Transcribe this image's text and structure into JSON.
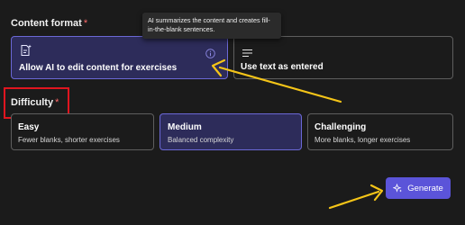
{
  "content_format": {
    "label": "Content format",
    "required_marker": "*",
    "tooltip": "AI summarizes the content and creates fill-in-the-blank sentences.",
    "options": [
      {
        "title": "Allow AI to edit content for exercises",
        "icon": "ai-edit-icon",
        "selected": true
      },
      {
        "title": "Use text as entered",
        "icon": "text-lines-icon",
        "selected": false
      }
    ]
  },
  "difficulty": {
    "label": "Difficulty",
    "required_marker": "*",
    "options": [
      {
        "title": "Easy",
        "description": "Fewer blanks, shorter exercises",
        "selected": false
      },
      {
        "title": "Medium",
        "description": "Balanced complexity",
        "selected": true
      },
      {
        "title": "Challenging",
        "description": "More blanks, longer exercises",
        "selected": false
      }
    ]
  },
  "generate_button": {
    "label": "Generate",
    "icon": "sparkle-icon"
  },
  "colors": {
    "background": "#1b1b1b",
    "selected_card": "#2d2c5a",
    "accent": "#5b54d9",
    "annotation_arrow": "#f5c518",
    "annotation_box": "#e0151f"
  }
}
